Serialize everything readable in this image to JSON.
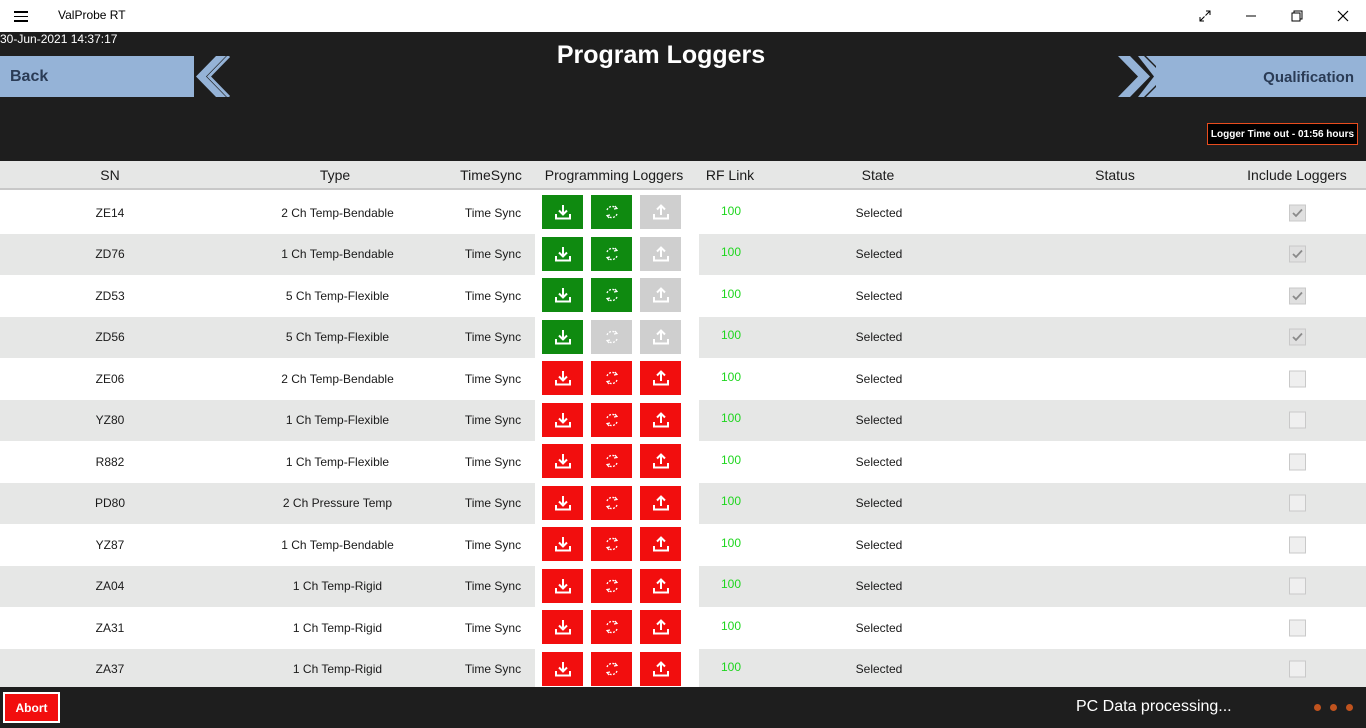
{
  "app": {
    "title": "ValProbe RT"
  },
  "header": {
    "datetime": "30-Jun-2021 14:37:17",
    "title": "Program Loggers",
    "back_label": "Back",
    "next_label": "Qualification",
    "timeout": "Logger Time out - 01:56 hours"
  },
  "columns": {
    "sn": "SN",
    "type": "Type",
    "timesync": "TimeSync",
    "programming": "Programming Loggers",
    "rflink": "RF Link",
    "state": "State",
    "status": "Status",
    "include": "Include Loggers"
  },
  "rows": [
    {
      "sn": "ZE14",
      "type": "2 Ch Temp-Bendable",
      "timesync": "Time Sync",
      "rf": "100",
      "state": "Selected",
      "status": "",
      "buttons": [
        "green",
        "green",
        "grey"
      ],
      "include": true
    },
    {
      "sn": "ZD76",
      "type": "1 Ch Temp-Bendable",
      "timesync": "Time Sync",
      "rf": "100",
      "state": "Selected",
      "status": "",
      "buttons": [
        "green",
        "green",
        "grey"
      ],
      "include": true
    },
    {
      "sn": "ZD53",
      "type": "5 Ch Temp-Flexible",
      "timesync": "Time Sync",
      "rf": "100",
      "state": "Selected",
      "status": "",
      "buttons": [
        "green",
        "green",
        "grey"
      ],
      "include": true
    },
    {
      "sn": "ZD56",
      "type": "5 Ch Temp-Flexible",
      "timesync": "Time Sync",
      "rf": "100",
      "state": "Selected",
      "status": "",
      "buttons": [
        "green",
        "grey",
        "grey"
      ],
      "include": true
    },
    {
      "sn": "ZE06",
      "type": "2 Ch Temp-Bendable",
      "timesync": "Time Sync",
      "rf": "100",
      "state": "Selected",
      "status": "",
      "buttons": [
        "red",
        "red",
        "red"
      ],
      "include": false
    },
    {
      "sn": "YZ80",
      "type": "1 Ch Temp-Flexible",
      "timesync": "Time Sync",
      "rf": "100",
      "state": "Selected",
      "status": "",
      "buttons": [
        "red",
        "red",
        "red"
      ],
      "include": false
    },
    {
      "sn": "R882",
      "type": "1 Ch Temp-Flexible",
      "timesync": "Time Sync",
      "rf": "100",
      "state": "Selected",
      "status": "",
      "buttons": [
        "red",
        "red",
        "red"
      ],
      "include": false
    },
    {
      "sn": "PD80",
      "type": "2 Ch Pressure Temp",
      "timesync": "Time Sync",
      "rf": "100",
      "state": "Selected",
      "status": "",
      "buttons": [
        "red",
        "red",
        "red"
      ],
      "include": false
    },
    {
      "sn": "YZ87",
      "type": "1 Ch Temp-Bendable",
      "timesync": "Time Sync",
      "rf": "100",
      "state": "Selected",
      "status": "",
      "buttons": [
        "red",
        "red",
        "red"
      ],
      "include": false
    },
    {
      "sn": "ZA04",
      "type": "1 Ch Temp-Rigid",
      "timesync": "Time Sync",
      "rf": "100",
      "state": "Selected",
      "status": "",
      "buttons": [
        "red",
        "red",
        "red"
      ],
      "include": false
    },
    {
      "sn": "ZA31",
      "type": "1 Ch Temp-Rigid",
      "timesync": "Time Sync",
      "rf": "100",
      "state": "Selected",
      "status": "",
      "buttons": [
        "red",
        "red",
        "red"
      ],
      "include": false
    },
    {
      "sn": "ZA37",
      "type": "1 Ch Temp-Rigid",
      "timesync": "Time Sync",
      "rf": "100",
      "state": "Selected",
      "status": "",
      "buttons": [
        "red",
        "red",
        "red"
      ],
      "include": false
    }
  ],
  "footer": {
    "abort_label": "Abort",
    "status": "PC Data processing..."
  },
  "colors": {
    "accent_blue": "#95b3d7",
    "green": "#0f8a10",
    "red": "#f20e0e",
    "grey": "#cfcfcf",
    "rf_green": "#1ed61e",
    "timeout_border": "#e84c1e"
  }
}
